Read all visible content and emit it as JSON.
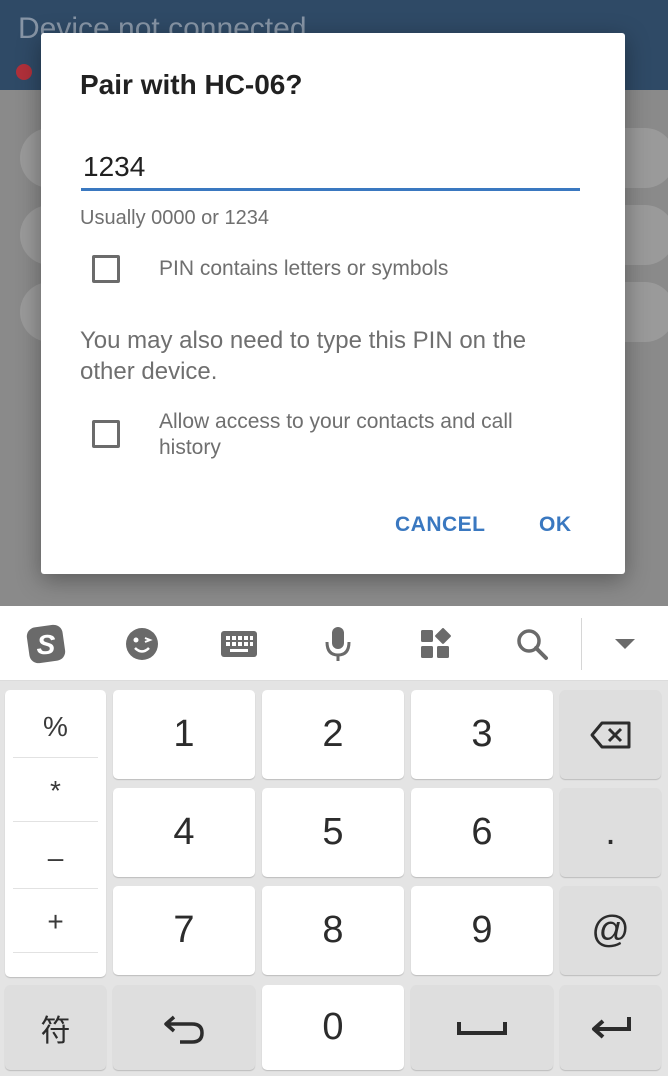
{
  "app": {
    "title": "Device not connected"
  },
  "dialog": {
    "title": "Pair with HC-06?",
    "pin_value": "1234",
    "pin_hint": "Usually 0000 or 1234",
    "checkbox_letters_label": "PIN contains letters or symbols",
    "note": "You may also need to type this PIN on the other device.",
    "checkbox_contacts_label": "Allow access to your contacts and call history",
    "cancel_label": "CANCEL",
    "ok_label": "OK"
  },
  "keyboard": {
    "toolbar_icons": [
      "sogou-logo-icon",
      "emoji-icon",
      "keyboard-icon",
      "microphone-icon",
      "apps-grid-icon",
      "search-icon",
      "collapse-down-icon"
    ],
    "symbols": [
      "%",
      "*",
      "–",
      "+",
      ","
    ],
    "digits": [
      "1",
      "2",
      "3",
      "4",
      "5",
      "6",
      "7",
      "8",
      "9",
      "0"
    ],
    "period_key": ".",
    "at_key": "@",
    "symbols_key": "符"
  },
  "colors": {
    "accent": "#3a78c0",
    "header": "#2f4a66",
    "status_dot": "#b0303a"
  }
}
